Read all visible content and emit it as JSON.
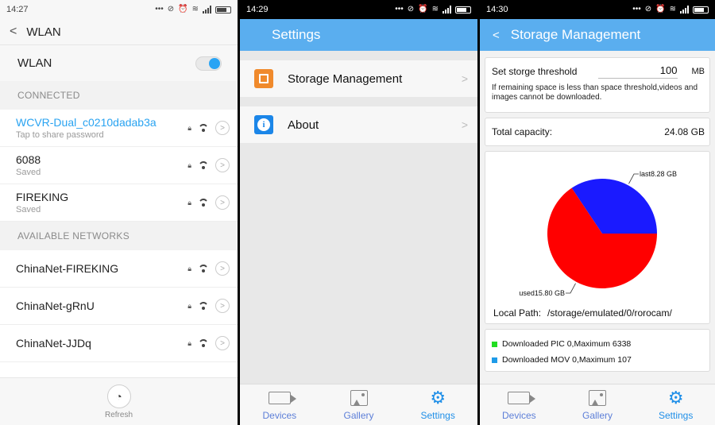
{
  "panel1": {
    "status": {
      "time": "14:27"
    },
    "title": "WLAN",
    "wlan_label": "WLAN",
    "connected_header": "CONNECTED",
    "connected": [
      {
        "name": "WCVR-Dual_c0210dadab3a",
        "sub": "Tap to share password",
        "active": true
      },
      {
        "name": "6088",
        "sub": "Saved",
        "active": false
      },
      {
        "name": "FIREKING",
        "sub": "Saved",
        "active": false
      }
    ],
    "available_header": "AVAILABLE NETWORKS",
    "available": [
      {
        "name": "ChinaNet-FIREKING"
      },
      {
        "name": "ChinaNet-gRnU"
      },
      {
        "name": "ChinaNet-JJDq"
      }
    ],
    "refresh_label": "Refresh"
  },
  "panel2": {
    "status": {
      "time": "14:29"
    },
    "title": "Settings",
    "items": [
      {
        "label": "Storage Management",
        "icon": "storage-icon"
      },
      {
        "label": "About",
        "icon": "info-icon"
      }
    ]
  },
  "panel3": {
    "status": {
      "time": "14:30"
    },
    "title": "Storage Management",
    "threshold_label": "Set storge threshold",
    "threshold_value": "100",
    "threshold_unit": "MB",
    "threshold_note": "If remaining space is less than space threshold,videos and images cannot be downloaded.",
    "capacity_label": "Total capacity:",
    "capacity_value": "24.08 GB",
    "local_path_label": "Local Path:",
    "local_path_value": "/storage/emulated/0/rorocam/",
    "downloads": [
      {
        "text": "Downloaded PIC 0,Maximum 6338",
        "color": "#22dd22"
      },
      {
        "text": "Downloaded MOV 0,Maximum 107",
        "color": "#1e9be8"
      }
    ]
  },
  "nav": {
    "devices": "Devices",
    "gallery": "Gallery",
    "settings": "Settings"
  },
  "chart_data": {
    "type": "pie",
    "slices": [
      {
        "label": "last8.28 GB",
        "value": 8.28,
        "color": "#1a1aff"
      },
      {
        "label": "used15.80 GB",
        "value": 15.8,
        "color": "#ff0000"
      }
    ]
  }
}
